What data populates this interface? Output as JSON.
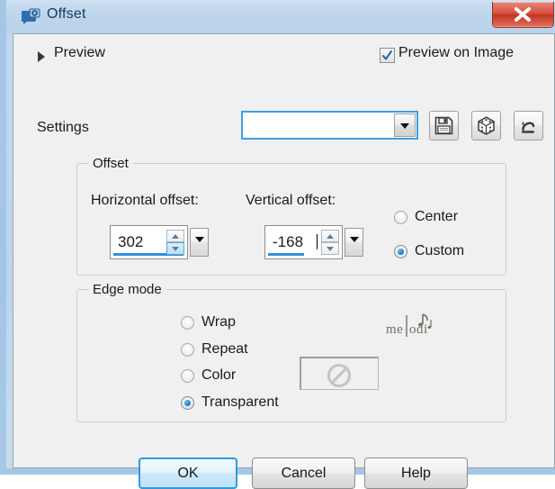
{
  "window": {
    "title": "Offset",
    "icon": "camera-icon",
    "close_label": "×",
    "accent_blue": "#2f8fe0",
    "titlebar_color": "#bed5ec",
    "close_color": "#c33523"
  },
  "preview": {
    "disclosure_label": "Preview",
    "on_image_label": "Preview on Image",
    "on_image_checked": true
  },
  "settings": {
    "label": "Settings",
    "combo_value": "",
    "combo_placeholder": "",
    "buttons": [
      {
        "name": "save-preset-button",
        "icon": "floppy-disk-icon"
      },
      {
        "name": "randomize-button",
        "icon": "dice-icon"
      },
      {
        "name": "reset-button",
        "icon": "reset-arrow-icon"
      }
    ]
  },
  "offset_group": {
    "legend": "Offset",
    "horizontal_label": "Horizontal offset:",
    "horizontal_value": "302",
    "vertical_label": "Vertical offset:",
    "vertical_value": "-168",
    "mode_options": [
      {
        "label": "Center",
        "selected": false
      },
      {
        "label": "Custom",
        "selected": true
      }
    ]
  },
  "edge_group": {
    "legend": "Edge mode",
    "options": [
      {
        "label": "Wrap",
        "selected": false
      },
      {
        "label": "Repeat",
        "selected": false
      },
      {
        "label": "Color",
        "selected": false
      },
      {
        "label": "Transparent",
        "selected": true
      }
    ],
    "color_swatch": {
      "name": "edge-color-swatch",
      "enabled": false,
      "icon": "no-entry-icon"
    },
    "watermark": "melodi"
  },
  "footer": {
    "ok": "OK",
    "cancel": "Cancel",
    "help": "Help"
  }
}
